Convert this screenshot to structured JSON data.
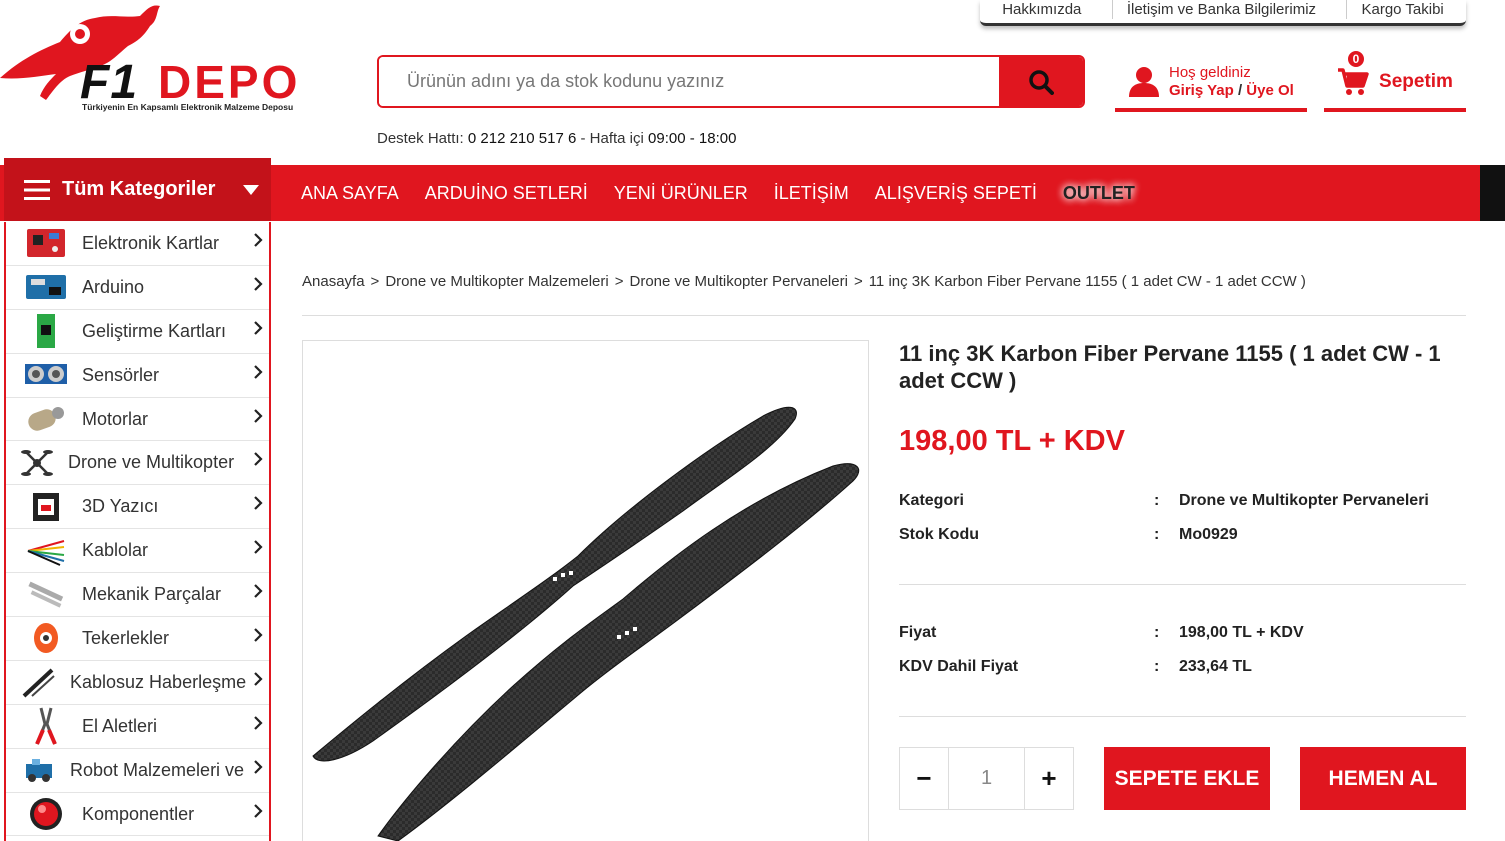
{
  "header": {
    "top_links": [
      "Hakkımızda",
      "İletişim ve Banka Bilgilerimiz",
      "Kargo Takibi"
    ],
    "logo_text": "F1 DEPO",
    "logo_tagline": "Türkiyenin En Kapsamlı Elektronik Malzeme Deposu",
    "search_placeholder": "Ürünün adını ya da stok kodunu yazınız",
    "support_label": "Destek Hattı:",
    "support_phone": "0 212 210 517 6",
    "support_hours_label": "- Hafta içi",
    "support_hours": "09:00 - 18:00",
    "user_greeting": "Hoş geldiniz",
    "login_label": "Giriş Yap",
    "login_sep": "/",
    "register_label": "Üye Ol",
    "cart_count": "0",
    "cart_label": "Sepetim"
  },
  "nav": {
    "all_categories": "Tüm Kategoriler",
    "items": [
      "ANA SAYFA",
      "ARDUİNO SETLERİ",
      "YENİ ÜRÜNLER",
      "İLETİŞİM",
      "ALIŞVERİŞ SEPETİ",
      "OUTLET"
    ]
  },
  "sidebar": {
    "items": [
      {
        "label": "Elektronik Kartlar",
        "icon": "board-icon"
      },
      {
        "label": "Arduino",
        "icon": "arduino-icon"
      },
      {
        "label": "Geliştirme Kartları",
        "icon": "dev-board-icon"
      },
      {
        "label": "Sensörler",
        "icon": "sensor-icon"
      },
      {
        "label": "Motorlar",
        "icon": "motor-icon"
      },
      {
        "label": "Drone ve Multikopter",
        "icon": "drone-icon"
      },
      {
        "label": "3D Yazıcı",
        "icon": "printer-3d-icon"
      },
      {
        "label": "Kablolar",
        "icon": "cable-icon"
      },
      {
        "label": "Mekanik Parçalar",
        "icon": "mechanical-part-icon"
      },
      {
        "label": "Tekerlekler",
        "icon": "wheel-icon"
      },
      {
        "label": "Kablosuz Haberleşme",
        "icon": "antenna-icon"
      },
      {
        "label": "El Aletleri",
        "icon": "pliers-icon"
      },
      {
        "label": "Robot Malzemeleri ve",
        "icon": "robot-icon"
      },
      {
        "label": "Komponentler",
        "icon": "component-icon"
      }
    ]
  },
  "breadcrumb": {
    "sep": ">",
    "items": [
      "Anasayfa",
      "Drone ve Multikopter Malzemeleri",
      "Drone ve Multikopter Pervaneleri",
      "11 inç 3K Karbon Fiber Pervane 1155 ( 1 adet CW - 1 adet CCW )"
    ]
  },
  "product": {
    "title": "11 inç 3K Karbon Fiber Pervane 1155 ( 1 adet CW - 1 adet CCW )",
    "price": "198,00 TL + KDV",
    "category_label": "Kategori",
    "category_value": "Drone ve Multikopter Pervaneleri",
    "stock_label": "Stok Kodu",
    "stock_value": "Mo0929",
    "price_label": "Fiyat",
    "price_value": "198,00 TL + KDV",
    "vat_label": "KDV Dahil Fiyat",
    "vat_value": "233,64 TL",
    "colon": ":",
    "quantity": "1",
    "minus": "−",
    "plus": "+",
    "add_to_cart": "SEPETE EKLE",
    "buy_now": "HEMEN AL"
  },
  "colors": {
    "brand_red": "#e0161f",
    "dark_red": "#c3121a"
  }
}
